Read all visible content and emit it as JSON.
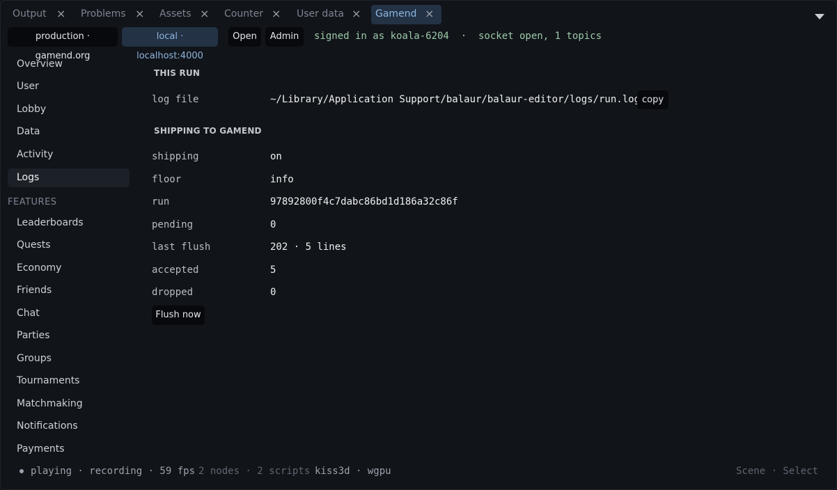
{
  "tabs": [
    {
      "label": "Output",
      "close": "×"
    },
    {
      "label": "Problems",
      "close": "×"
    },
    {
      "label": "Assets",
      "close": "×"
    },
    {
      "label": "Counter",
      "close": "×"
    },
    {
      "label": "User data",
      "close": "×"
    },
    {
      "label": "Gamend",
      "close": "×"
    }
  ],
  "env": {
    "production": "production · gamend.org",
    "local": "local · localhost:4000",
    "open": "Open",
    "admin": "Admin",
    "status": "signed in as koala-6204  ·  socket open, 1 topics"
  },
  "sidebar": {
    "items": [
      "Overview",
      "User",
      "Lobby",
      "Data",
      "Activity",
      "Logs"
    ],
    "features_label": "FEATURES",
    "features": [
      "Leaderboards",
      "Quests",
      "Economy",
      "Friends",
      "Chat",
      "Parties",
      "Groups",
      "Tournaments",
      "Matchmaking",
      "Notifications",
      "Payments"
    ]
  },
  "this_run": {
    "title": "THIS RUN",
    "log_file_key": "log file",
    "log_file_value": "~/Library/Application Support/balaur/balaur-editor/logs/run.log",
    "copy": "copy"
  },
  "shipping": {
    "title": "SHIPPING TO GAMEND",
    "rows": [
      {
        "key": "shipping",
        "value": "on"
      },
      {
        "key": "floor",
        "value": "info"
      },
      {
        "key": "run",
        "value": "97892800f4c7dabc86bd1d186a32c86f"
      },
      {
        "key": "pending",
        "value": "0"
      },
      {
        "key": "last flush",
        "value": "202 · 5 lines"
      },
      {
        "key": "accepted",
        "value": "5"
      },
      {
        "key": "dropped",
        "value": "0"
      }
    ],
    "flush_button": "Flush now"
  },
  "statusbar": {
    "left_bright": "playing · recording · 59 fps",
    "left_dim": "2 nodes · 2 scripts",
    "left_bright2": "kiss3d · wgpu",
    "right": "Scene · Select"
  }
}
